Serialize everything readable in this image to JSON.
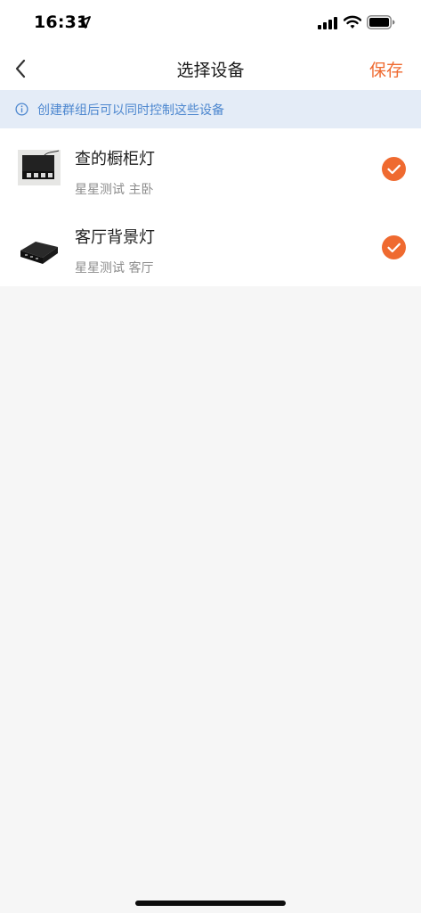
{
  "status_bar": {
    "time": "16:31",
    "icons": [
      "location-arrow-icon",
      "cellular-signal-icon",
      "wifi-icon",
      "battery-icon"
    ]
  },
  "nav": {
    "back_icon": "chevron-left-icon",
    "title": "选择设备",
    "save_label": "保存"
  },
  "info_banner": {
    "icon": "info-circle-icon",
    "text": "创建群组后可以同时控制这些设备"
  },
  "devices": [
    {
      "name": "查的橱柜灯",
      "location": "星星测试 主卧",
      "thumbnail": "device-controller-thumbnail",
      "selected": true
    },
    {
      "name": "客厅背景灯",
      "location": "星星测试 客厅",
      "thumbnail": "device-controller-thumbnail",
      "selected": true
    }
  ],
  "colors": {
    "accent": "#ef6a30",
    "info_text": "#4d87cf",
    "info_background": "#e4ecf7",
    "page_background": "#f6f6f6"
  }
}
